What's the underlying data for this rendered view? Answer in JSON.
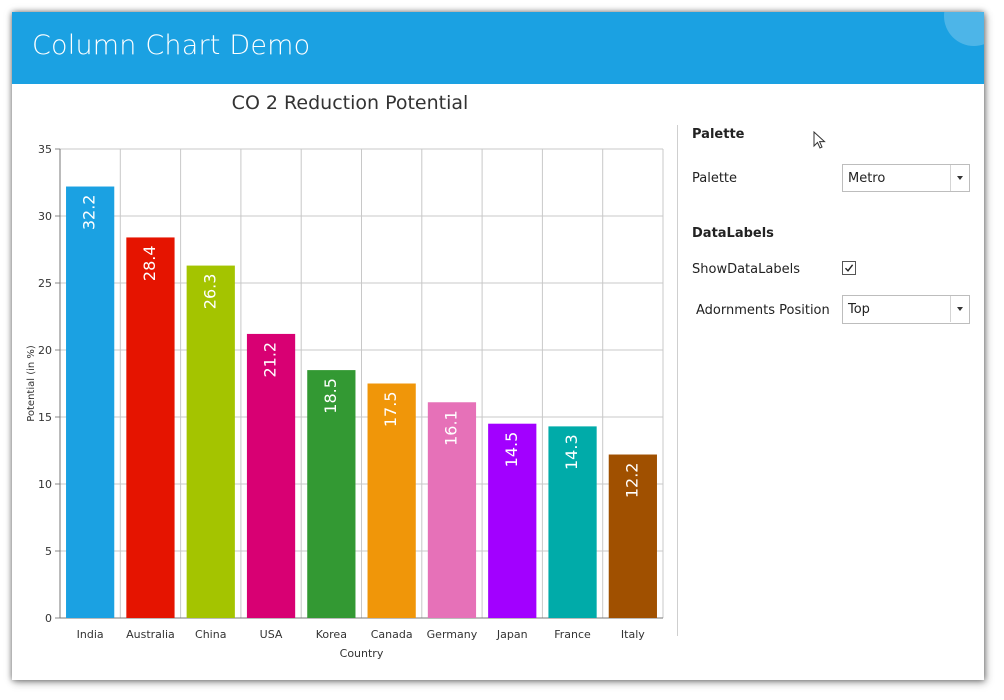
{
  "window": {
    "title": "Column Chart Demo",
    "close_label": "×",
    "accent_color": "#1ba1e2"
  },
  "chart_data": {
    "type": "bar",
    "title": "CO 2  Reduction Potential",
    "xlabel": "Country",
    "ylabel": "Potential (in %)",
    "ylim": [
      0,
      35
    ],
    "yticks": [
      0,
      5,
      10,
      15,
      20,
      25,
      30,
      35
    ],
    "categories": [
      "India",
      "Australia",
      "China",
      "USA",
      "Korea",
      "Canada",
      "Germany",
      "Japan",
      "France",
      "Italy"
    ],
    "values": [
      32.2,
      28.4,
      26.3,
      21.2,
      18.5,
      17.5,
      16.1,
      14.5,
      14.3,
      12.2
    ],
    "colors": [
      "#1ba1e2",
      "#e51400",
      "#a4c400",
      "#d80073",
      "#339933",
      "#f09609",
      "#e671b8",
      "#a200ff",
      "#00aba9",
      "#a05000"
    ],
    "data_labels": true,
    "grid": true
  },
  "panel": {
    "palette_header": "Palette",
    "palette_label": "Palette",
    "palette_value": "Metro",
    "datalabels_header": "DataLabels",
    "show_datalabels_label": "ShowDataLabels",
    "show_datalabels_checked": true,
    "adornments_label": "Adornments Position",
    "adornments_value": "Top"
  }
}
